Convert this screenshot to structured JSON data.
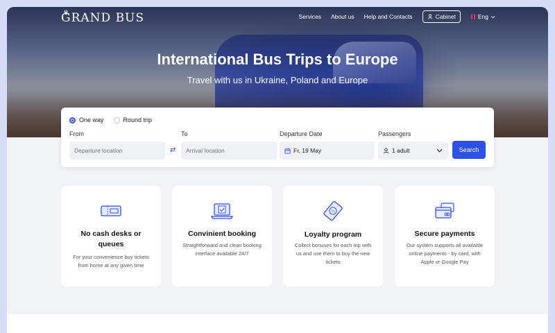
{
  "header": {
    "logo": "GRAND BUS",
    "nav": [
      "Services",
      "About us",
      "Help and Contacts"
    ],
    "cabinet": "Cabinet",
    "lang": "Eng"
  },
  "hero": {
    "title": "International Bus Trips to Europe",
    "subtitle": "Travel with us in Ukraine, Poland and Europe"
  },
  "search": {
    "trip_types": [
      "One way",
      "Round trip"
    ],
    "selected_trip": "One way",
    "from_label": "From",
    "from_placeholder": "Departure location",
    "to_label": "To",
    "to_placeholder": "Arrival location",
    "date_label": "Departure Date",
    "date_value": "Fr, 19 May",
    "passengers_label": "Passengers",
    "passengers_value": "1 adult",
    "button": "Search"
  },
  "features": [
    {
      "icon": "ticket-icon",
      "title": "No cash desks or queues",
      "desc": "For your convenience buy tickets from home at any given time"
    },
    {
      "icon": "laptop-booking-icon",
      "title": "Convinient booking",
      "desc": "Straightforward and clean booking interface available 24/7"
    },
    {
      "icon": "discount-ticket-icon",
      "title": "Loyalty program",
      "desc": "Collect bonuses for each trip with us and use them to buy the new tickets"
    },
    {
      "icon": "card-payment-icon",
      "title": "Secure payments",
      "desc": "Our system supports all available online payments - by card, with Apple or Google Pay"
    }
  ],
  "colors": {
    "accent": "#2d50e6",
    "page_bg": "#f2f3f7",
    "outer_bg": "#d6dcf5"
  }
}
